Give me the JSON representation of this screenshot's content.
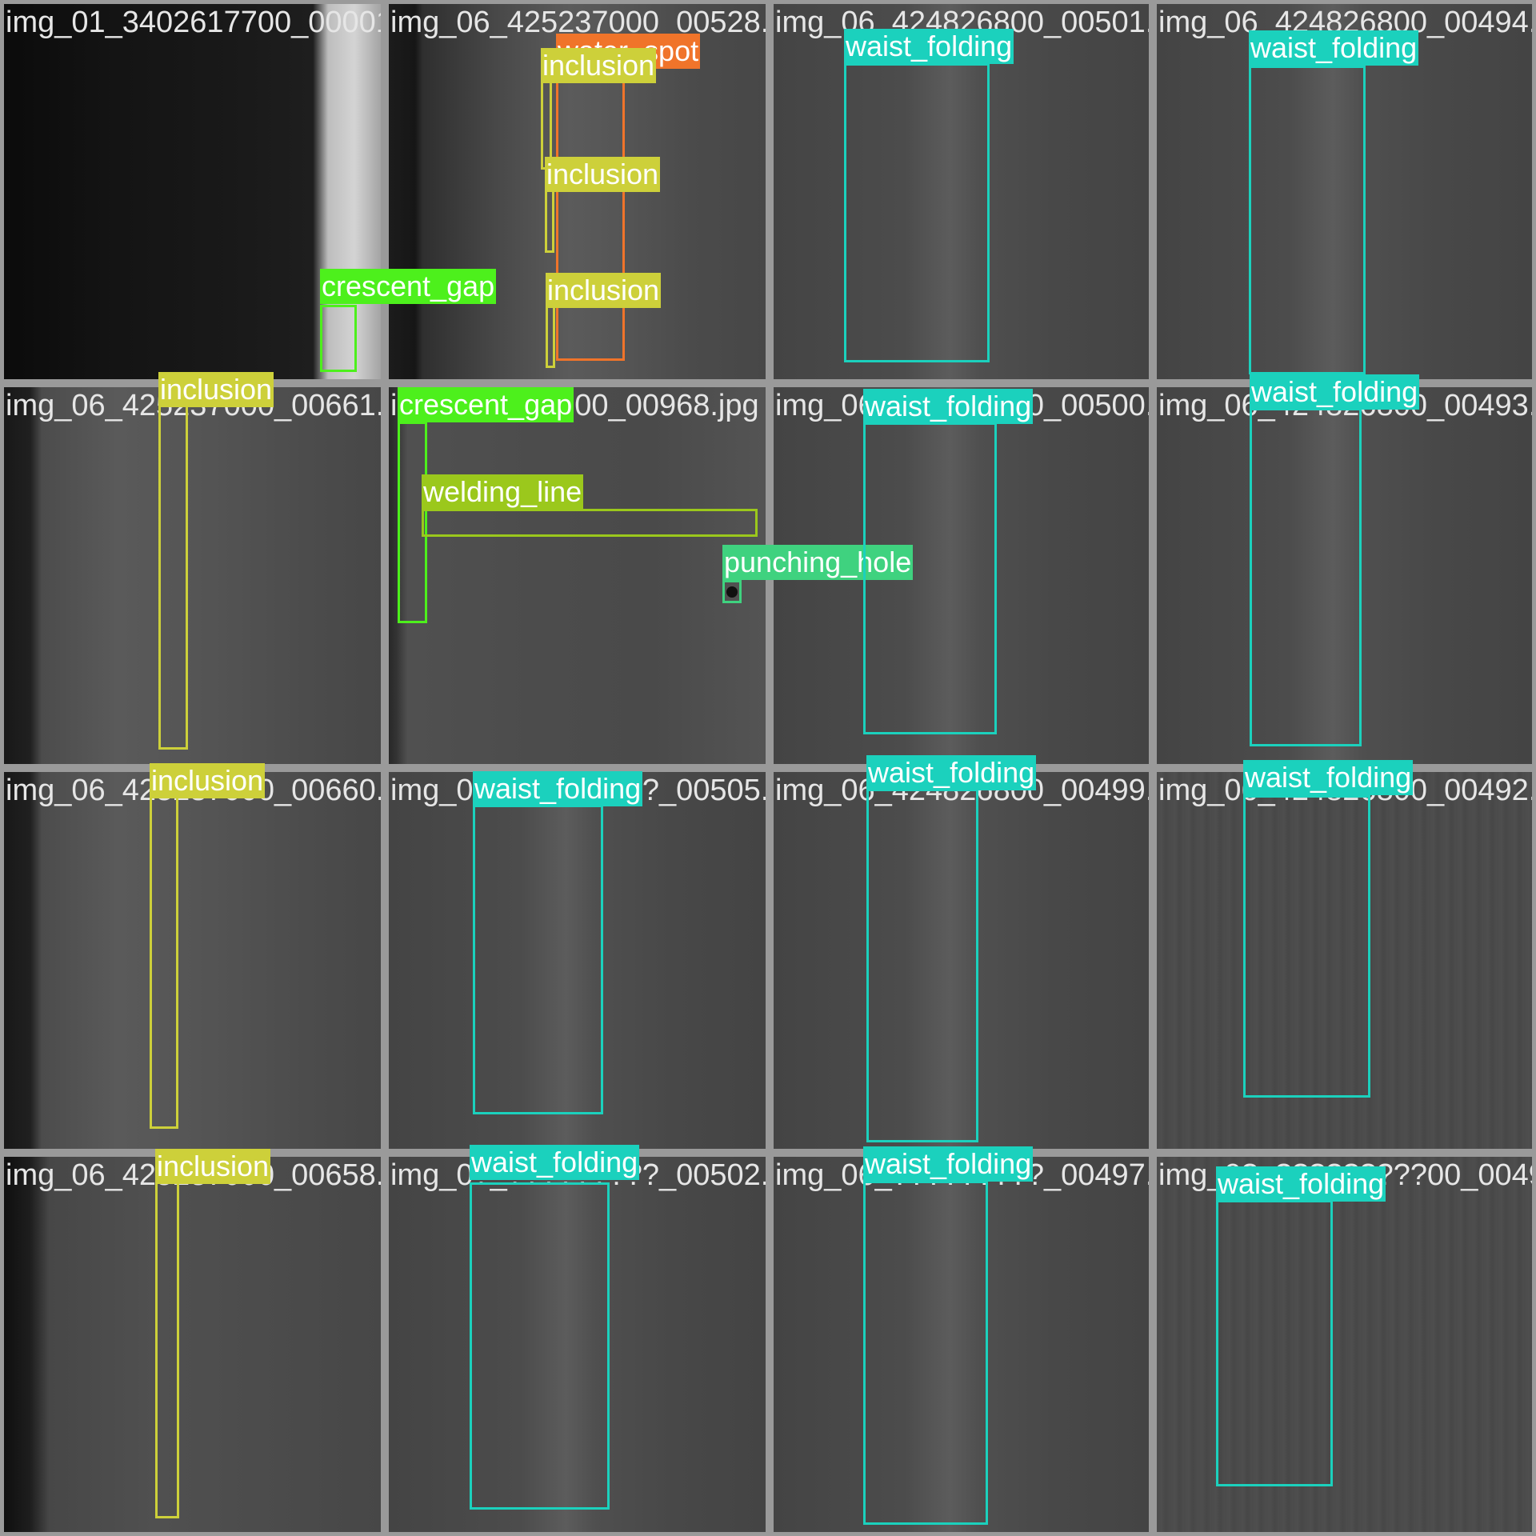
{
  "colors": {
    "inclusion": "#cdd03a",
    "water_spot": "#f0742a",
    "crescent_gap": "#4df01c",
    "waist_folding": "#1bd1bd",
    "welding_line": "#9bc81c",
    "punching_hole": "#3fd27f"
  },
  "tiles": [
    {
      "filename": "img_01_3402617700_00001.jpg"
    },
    {
      "filename": "img_06_425237000_00528.jpg"
    },
    {
      "filename": "img_06_424826800_00501.jpg"
    },
    {
      "filename": "img_06_424826800_00494.jpg"
    },
    {
      "filename": "img_06_425237000_00661.jpg"
    },
    {
      "filename": "img_0?_?03700_00968.jpg"
    },
    {
      "filename": "img_06_424826800_00500.jpg"
    },
    {
      "filename": "img_06_424826800_00493.jpg"
    },
    {
      "filename": "img_06_425237000_00660.jpg"
    },
    {
      "filename": "img_0?_?????????_00505.jpg"
    },
    {
      "filename": "img_06_424826800_00499.jpg"
    },
    {
      "filename": "img_06_424826800_00492.jpg"
    },
    {
      "filename": "img_06_425237000_00658.jpg"
    },
    {
      "filename": "img_0?_?????????_00502.jpg"
    },
    {
      "filename": "img_06_?????????_00497.jpg"
    },
    {
      "filename": "img_0?_?????????00_00490.jpg"
    }
  ],
  "detections": {
    "t0_crescent_gap": "crescent_gap",
    "t1_water_spot": "water_spot",
    "t1_inclusion_a": "inclusion",
    "t1_inclusion_b": "inclusion",
    "t1_inclusion_c": "inclusion",
    "t2_waist_folding": "waist_folding",
    "t3_waist_folding": "waist_folding",
    "t4_inclusion": "inclusion",
    "t5_crescent_gap": "crescent_gap",
    "t5_welding_line": "welding_line",
    "t5_punching_hole": "punching_hole",
    "t6_waist_folding": "waist_folding",
    "t7_waist_folding": "waist_folding",
    "t8_inclusion": "inclusion",
    "t9_waist_folding": "waist_folding",
    "t10_waist_folding": "waist_folding",
    "t11_waist_folding": "waist_folding",
    "t12_inclusion": "inclusion",
    "t13_waist_folding": "waist_folding",
    "t14_waist_folding": "waist_folding",
    "t15_waist_folding": "waist_folding"
  }
}
